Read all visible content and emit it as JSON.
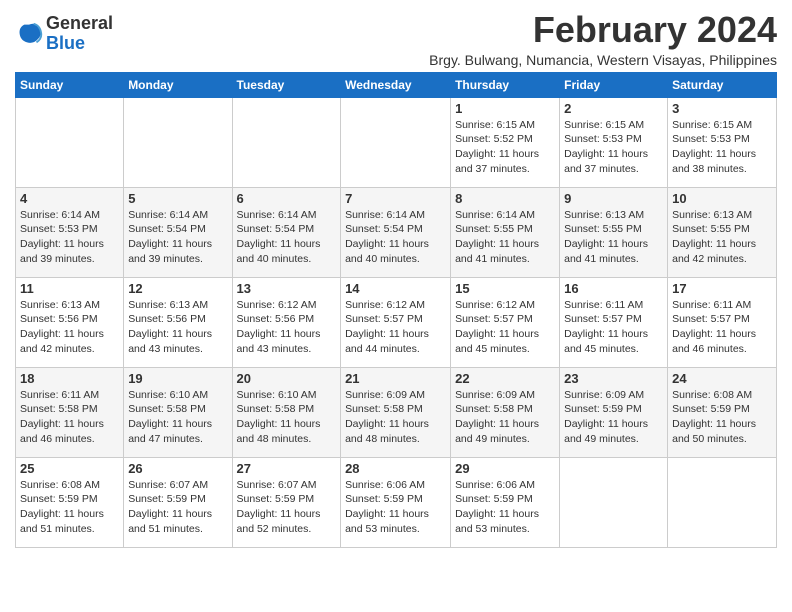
{
  "header": {
    "logo_general": "General",
    "logo_blue": "Blue",
    "month_title": "February 2024",
    "location": "Brgy. Bulwang, Numancia, Western Visayas, Philippines"
  },
  "weekdays": [
    "Sunday",
    "Monday",
    "Tuesday",
    "Wednesday",
    "Thursday",
    "Friday",
    "Saturday"
  ],
  "weeks": [
    [
      {
        "day": "",
        "sunrise": "",
        "sunset": "",
        "daylight": ""
      },
      {
        "day": "",
        "sunrise": "",
        "sunset": "",
        "daylight": ""
      },
      {
        "day": "",
        "sunrise": "",
        "sunset": "",
        "daylight": ""
      },
      {
        "day": "",
        "sunrise": "",
        "sunset": "",
        "daylight": ""
      },
      {
        "day": "1",
        "sunrise": "Sunrise: 6:15 AM",
        "sunset": "Sunset: 5:52 PM",
        "daylight": "Daylight: 11 hours and 37 minutes."
      },
      {
        "day": "2",
        "sunrise": "Sunrise: 6:15 AM",
        "sunset": "Sunset: 5:53 PM",
        "daylight": "Daylight: 11 hours and 37 minutes."
      },
      {
        "day": "3",
        "sunrise": "Sunrise: 6:15 AM",
        "sunset": "Sunset: 5:53 PM",
        "daylight": "Daylight: 11 hours and 38 minutes."
      }
    ],
    [
      {
        "day": "4",
        "sunrise": "Sunrise: 6:14 AM",
        "sunset": "Sunset: 5:53 PM",
        "daylight": "Daylight: 11 hours and 39 minutes."
      },
      {
        "day": "5",
        "sunrise": "Sunrise: 6:14 AM",
        "sunset": "Sunset: 5:54 PM",
        "daylight": "Daylight: 11 hours and 39 minutes."
      },
      {
        "day": "6",
        "sunrise": "Sunrise: 6:14 AM",
        "sunset": "Sunset: 5:54 PM",
        "daylight": "Daylight: 11 hours and 40 minutes."
      },
      {
        "day": "7",
        "sunrise": "Sunrise: 6:14 AM",
        "sunset": "Sunset: 5:54 PM",
        "daylight": "Daylight: 11 hours and 40 minutes."
      },
      {
        "day": "8",
        "sunrise": "Sunrise: 6:14 AM",
        "sunset": "Sunset: 5:55 PM",
        "daylight": "Daylight: 11 hours and 41 minutes."
      },
      {
        "day": "9",
        "sunrise": "Sunrise: 6:13 AM",
        "sunset": "Sunset: 5:55 PM",
        "daylight": "Daylight: 11 hours and 41 minutes."
      },
      {
        "day": "10",
        "sunrise": "Sunrise: 6:13 AM",
        "sunset": "Sunset: 5:55 PM",
        "daylight": "Daylight: 11 hours and 42 minutes."
      }
    ],
    [
      {
        "day": "11",
        "sunrise": "Sunrise: 6:13 AM",
        "sunset": "Sunset: 5:56 PM",
        "daylight": "Daylight: 11 hours and 42 minutes."
      },
      {
        "day": "12",
        "sunrise": "Sunrise: 6:13 AM",
        "sunset": "Sunset: 5:56 PM",
        "daylight": "Daylight: 11 hours and 43 minutes."
      },
      {
        "day": "13",
        "sunrise": "Sunrise: 6:12 AM",
        "sunset": "Sunset: 5:56 PM",
        "daylight": "Daylight: 11 hours and 43 minutes."
      },
      {
        "day": "14",
        "sunrise": "Sunrise: 6:12 AM",
        "sunset": "Sunset: 5:57 PM",
        "daylight": "Daylight: 11 hours and 44 minutes."
      },
      {
        "day": "15",
        "sunrise": "Sunrise: 6:12 AM",
        "sunset": "Sunset: 5:57 PM",
        "daylight": "Daylight: 11 hours and 45 minutes."
      },
      {
        "day": "16",
        "sunrise": "Sunrise: 6:11 AM",
        "sunset": "Sunset: 5:57 PM",
        "daylight": "Daylight: 11 hours and 45 minutes."
      },
      {
        "day": "17",
        "sunrise": "Sunrise: 6:11 AM",
        "sunset": "Sunset: 5:57 PM",
        "daylight": "Daylight: 11 hours and 46 minutes."
      }
    ],
    [
      {
        "day": "18",
        "sunrise": "Sunrise: 6:11 AM",
        "sunset": "Sunset: 5:58 PM",
        "daylight": "Daylight: 11 hours and 46 minutes."
      },
      {
        "day": "19",
        "sunrise": "Sunrise: 6:10 AM",
        "sunset": "Sunset: 5:58 PM",
        "daylight": "Daylight: 11 hours and 47 minutes."
      },
      {
        "day": "20",
        "sunrise": "Sunrise: 6:10 AM",
        "sunset": "Sunset: 5:58 PM",
        "daylight": "Daylight: 11 hours and 48 minutes."
      },
      {
        "day": "21",
        "sunrise": "Sunrise: 6:09 AM",
        "sunset": "Sunset: 5:58 PM",
        "daylight": "Daylight: 11 hours and 48 minutes."
      },
      {
        "day": "22",
        "sunrise": "Sunrise: 6:09 AM",
        "sunset": "Sunset: 5:58 PM",
        "daylight": "Daylight: 11 hours and 49 minutes."
      },
      {
        "day": "23",
        "sunrise": "Sunrise: 6:09 AM",
        "sunset": "Sunset: 5:59 PM",
        "daylight": "Daylight: 11 hours and 49 minutes."
      },
      {
        "day": "24",
        "sunrise": "Sunrise: 6:08 AM",
        "sunset": "Sunset: 5:59 PM",
        "daylight": "Daylight: 11 hours and 50 minutes."
      }
    ],
    [
      {
        "day": "25",
        "sunrise": "Sunrise: 6:08 AM",
        "sunset": "Sunset: 5:59 PM",
        "daylight": "Daylight: 11 hours and 51 minutes."
      },
      {
        "day": "26",
        "sunrise": "Sunrise: 6:07 AM",
        "sunset": "Sunset: 5:59 PM",
        "daylight": "Daylight: 11 hours and 51 minutes."
      },
      {
        "day": "27",
        "sunrise": "Sunrise: 6:07 AM",
        "sunset": "Sunset: 5:59 PM",
        "daylight": "Daylight: 11 hours and 52 minutes."
      },
      {
        "day": "28",
        "sunrise": "Sunrise: 6:06 AM",
        "sunset": "Sunset: 5:59 PM",
        "daylight": "Daylight: 11 hours and 53 minutes."
      },
      {
        "day": "29",
        "sunrise": "Sunrise: 6:06 AM",
        "sunset": "Sunset: 5:59 PM",
        "daylight": "Daylight: 11 hours and 53 minutes."
      },
      {
        "day": "",
        "sunrise": "",
        "sunset": "",
        "daylight": ""
      },
      {
        "day": "",
        "sunrise": "",
        "sunset": "",
        "daylight": ""
      }
    ]
  ]
}
